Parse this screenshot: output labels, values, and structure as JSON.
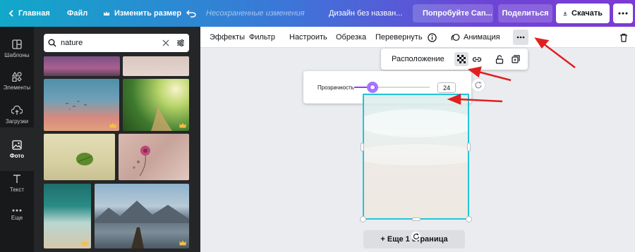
{
  "topbar": {
    "home_label": "Главная",
    "file_label": "Файл",
    "resize_label": "Изменить размер",
    "unsaved_label": "Несохраненные изменения",
    "doc_title": "Дизайн без назван...",
    "premium_label": "Попробуйте Can...",
    "share_label": "Поделиться",
    "download_label": "Скачать"
  },
  "rail": {
    "items": [
      {
        "label": "Шаблоны",
        "icon": "templates-icon"
      },
      {
        "label": "Элементы",
        "icon": "elements-icon"
      },
      {
        "label": "Загрузки",
        "icon": "upload-icon"
      },
      {
        "label": "Фото",
        "icon": "photo-icon"
      },
      {
        "label": "Текст",
        "icon": "text-icon"
      },
      {
        "label": "Еще",
        "icon": "more-icon"
      }
    ]
  },
  "search": {
    "value": "nature"
  },
  "toolbar": {
    "effects": "Эффекты",
    "filter": "Фильтр",
    "adjust": "Настроить",
    "crop": "Обрезка",
    "flip": "Перевернуть",
    "animation": "Анимация"
  },
  "position_popup": {
    "label": "Расположение"
  },
  "transparency": {
    "label": "Прозрачность",
    "value": "24",
    "level": 0.24
  },
  "add_page_label": "+ Еще 1 страница",
  "colors": {
    "accent": "#8b3dff",
    "selection": "#1fc6d6",
    "annotation": "#e02020"
  }
}
